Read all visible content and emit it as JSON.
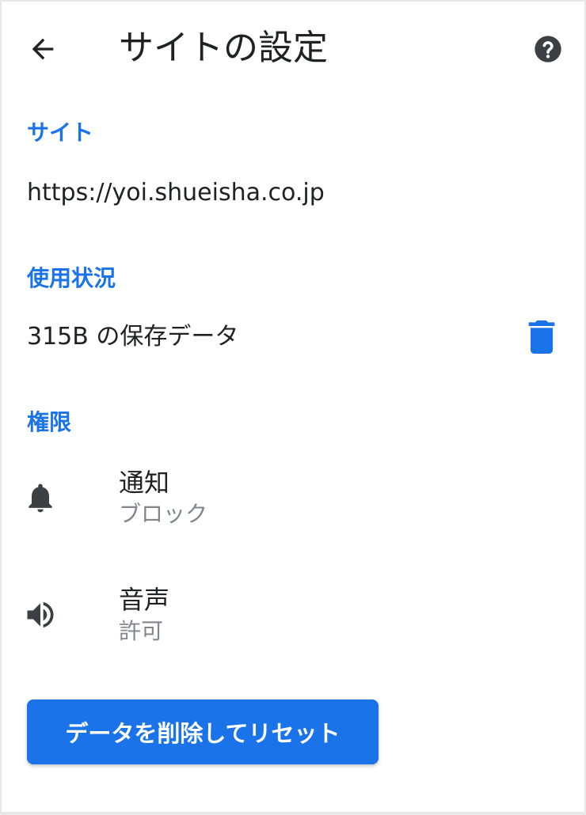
{
  "header": {
    "back_icon": "arrow-back-icon",
    "title": "サイトの設定",
    "help_icon": "help-icon"
  },
  "site_section": {
    "heading": "サイト",
    "url": "https://yoi.shueisha.co.jp"
  },
  "usage_section": {
    "heading": "使用状況",
    "stored_data": "315B の保存データ",
    "delete_icon": "trash-icon"
  },
  "permissions_section": {
    "heading": "権限",
    "items": [
      {
        "icon": "bell-icon",
        "title": "通知",
        "status": "ブロック"
      },
      {
        "icon": "speaker-icon",
        "title": "音声",
        "status": "許可"
      }
    ]
  },
  "reset_button": {
    "label": "データを削除してリセット"
  },
  "colors": {
    "accent": "#1a73e8",
    "text_primary": "#202124",
    "text_secondary": "#80868b",
    "icon": "#3c4043"
  }
}
